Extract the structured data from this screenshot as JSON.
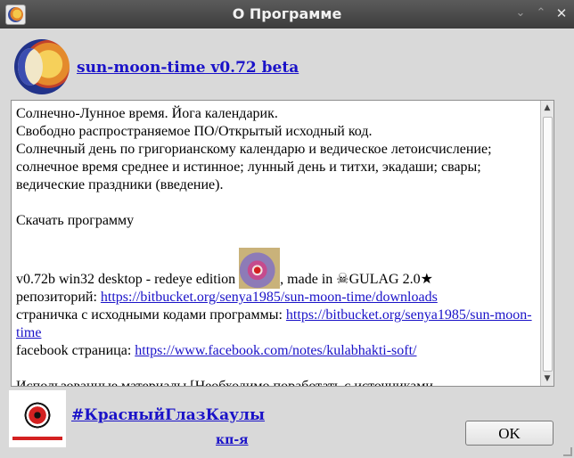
{
  "window": {
    "title": "О Программе",
    "minimize_glyph": "⌄",
    "maximize_glyph": "⌃",
    "close_glyph": "✕"
  },
  "header": {
    "app_name": "sun-moon-time v0.72 beta"
  },
  "content": {
    "line1": "Солнечно-Лунное время. Йога календарик.",
    "line2": "Свободно распространяемое ПО/Открытый исходный код.",
    "line3": "Солнечный день по григорианскому календарю и ведическое летоисчисление; солнечное время среднее и истинное; лунный день и титхи, экадаши; свары; ведические праздники (введение).",
    "download": "Скачать программу",
    "edition_prefix": "v0.72b win32 desktop - redeye edition",
    "edition_suffix": ", made in ☠GULAG 2.0★",
    "repo_label": "репозиторий:",
    "repo_url": "https://bitbucket.org/senya1985/sun-moon-time/downloads",
    "source_label": "страничка с исходными кодами программы:",
    "source_url": "https://bitbucket.org/senya1985/sun-moon-time",
    "facebook_label": "facebook страница:",
    "facebook_url": "https://www.facebook.com/notes/kulabhakti-soft/",
    "materials": "Использованные материалы [Необходимо поработать с источниками"
  },
  "footer": {
    "hashtag": "#КрасныйГлазКаулы",
    "sub_link": "кп-я",
    "ok_label": "OK"
  },
  "icons": {
    "title": "sun-moon-icon",
    "header": "sun-moon-logo",
    "footer": "red-eye-logo"
  },
  "colors": {
    "link": "#1a12c8",
    "titlebar": "#3c3c3c",
    "window_bg": "#d9d9d9"
  }
}
